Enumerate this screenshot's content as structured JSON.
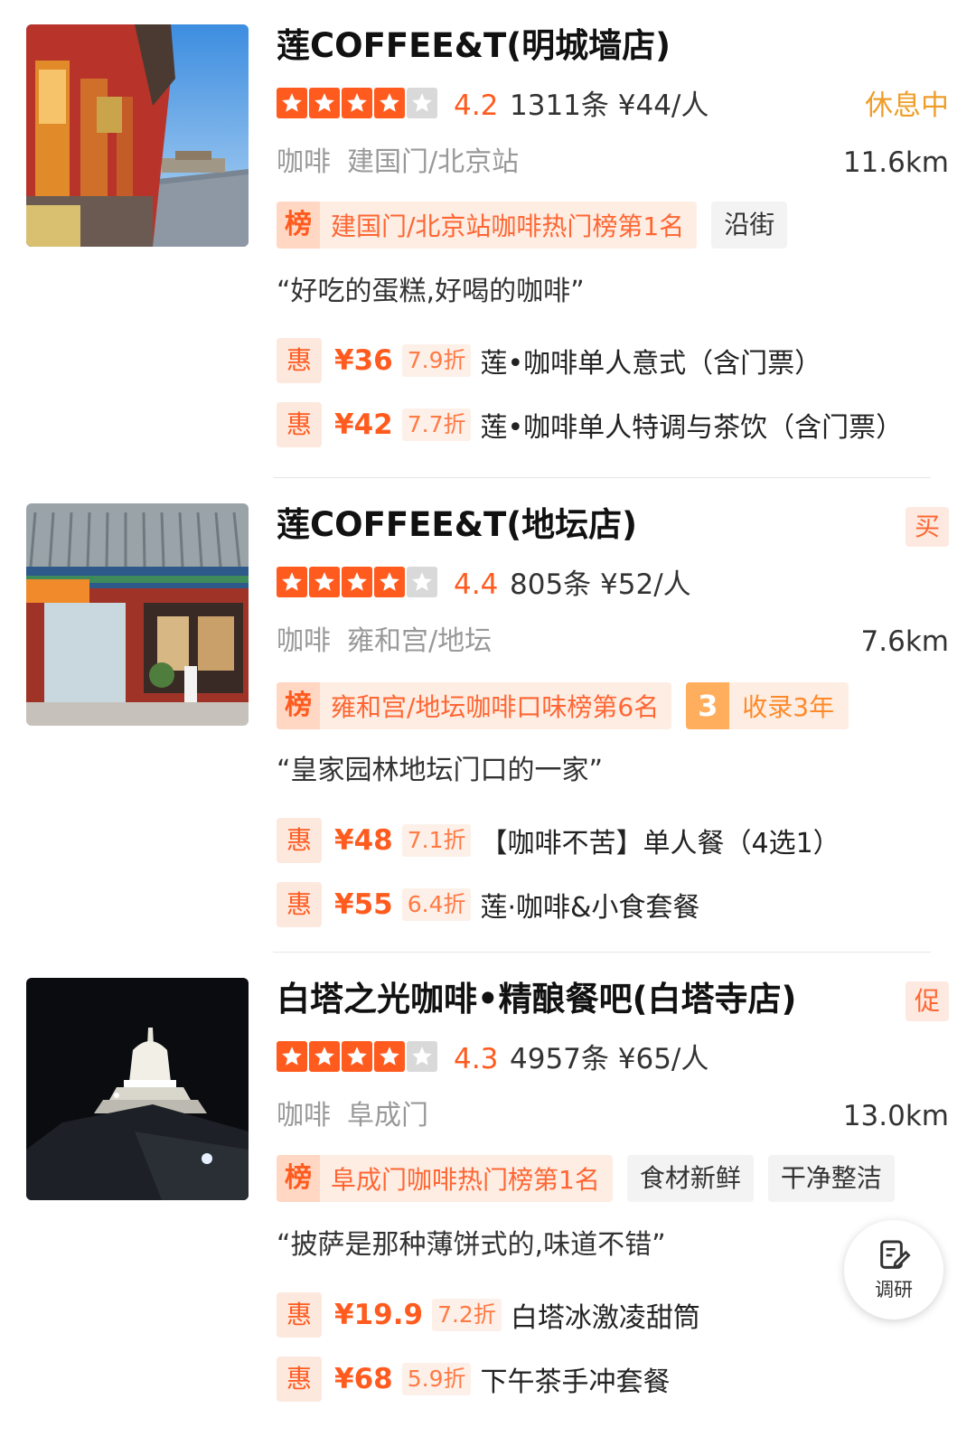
{
  "theme": {
    "accent": "#ff5b1f",
    "status_closed": "#ee9e2a",
    "badge_bg": "#fdede3",
    "neutral_tag_bg": "#f3f3f3"
  },
  "listings": [
    {
      "name": "莲COFFEE&T(明城墙店)",
      "rating_stars": 4,
      "score": "4.2",
      "reviews": "1311条",
      "per_person": "¥44/人",
      "status": "休息中",
      "category": "咖啡",
      "area": "建国门/北京站",
      "distance": "11.6km",
      "rank_icon": "榜",
      "rank_text": "建国门/北京站咖啡热门榜第1名",
      "tags": [
        "沿街"
      ],
      "quote": "“好吃的蛋糕,好喝的咖啡”",
      "deals": [
        {
          "icon": "惠",
          "price": "¥36",
          "discount": "7.9折",
          "title": "莲•咖啡单人意式（含门票）"
        },
        {
          "icon": "惠",
          "price": "¥42",
          "discount": "7.7折",
          "title": "莲•咖啡单人特调与茶饮（含门票）"
        }
      ]
    },
    {
      "name": "莲COFFEE&T(地坛店)",
      "flag": "买",
      "rating_stars": 4,
      "score": "4.4",
      "reviews": "805条",
      "per_person": "¥52/人",
      "category": "咖啡",
      "area": "雍和宫/地坛",
      "distance": "7.6km",
      "rank_icon": "榜",
      "rank_text": "雍和宫/地坛咖啡口味榜第6名",
      "year_icon": "3",
      "year_text": "收录3年",
      "quote": "“皇家园林地坛门口的一家”",
      "deals": [
        {
          "icon": "惠",
          "price": "¥48",
          "discount": "7.1折",
          "title": "【咖啡不苦】单人餐（4选1）"
        },
        {
          "icon": "惠",
          "price": "¥55",
          "discount": "6.4折",
          "title": "莲·咖啡&小食套餐"
        }
      ]
    },
    {
      "name": "白塔之光咖啡•精酿餐吧(白塔寺店)",
      "flag": "促",
      "rating_stars": 4,
      "score": "4.3",
      "reviews": "4957条",
      "per_person": "¥65/人",
      "category": "咖啡",
      "area": "阜成门",
      "distance": "13.0km",
      "rank_icon": "榜",
      "rank_text": "阜成门咖啡热门榜第1名",
      "tags": [
        "食材新鲜",
        "干净整洁"
      ],
      "quote": "“披萨是那种薄饼式的,味道不错”",
      "deals": [
        {
          "icon": "惠",
          "price": "¥19.9",
          "discount": "7.2折",
          "title": "白塔冰激凌甜筒"
        },
        {
          "icon": "惠",
          "price": "¥68",
          "discount": "5.9折",
          "title": "下午茶手冲套餐"
        }
      ]
    }
  ],
  "fab": {
    "icon": "edit-note-icon",
    "label": "调研"
  }
}
